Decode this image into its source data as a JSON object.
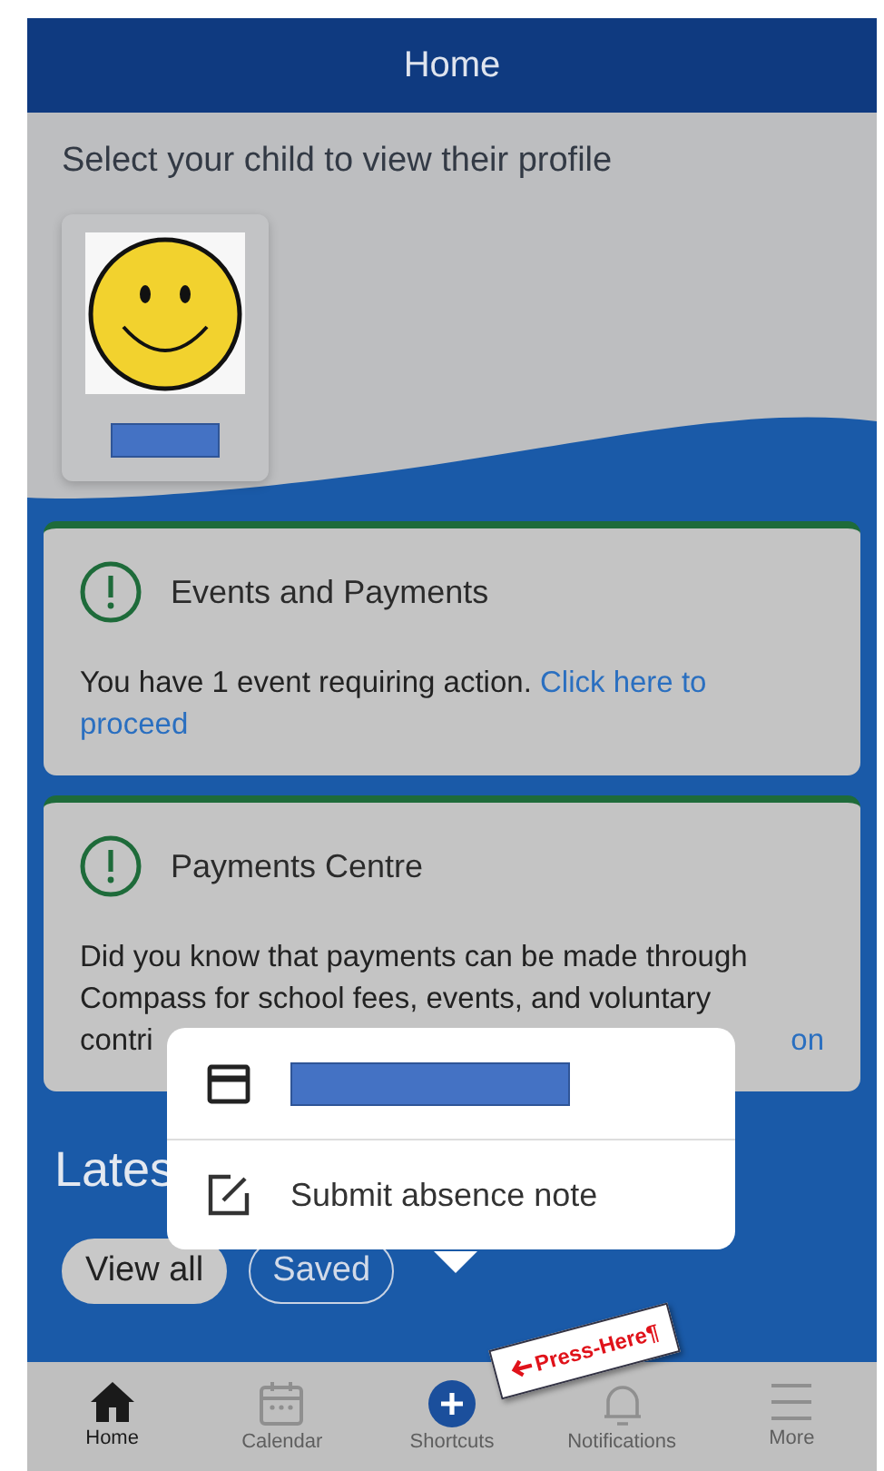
{
  "header": {
    "title": "Home"
  },
  "children_section": {
    "prompt": "Select your child to view their profile",
    "children": [
      {
        "name_redacted": true
      }
    ]
  },
  "cards": [
    {
      "title": "Events and Payments",
      "lines": [
        {
          "text": "You have 1 event requiring action. ",
          "link": "Click here to"
        },
        {
          "link": "proceed"
        }
      ]
    },
    {
      "title": "Payments Centre",
      "lines": [
        {
          "text": "Did you know that payments can be made through"
        },
        {
          "text": "Compass for school fees, events, and voluntary"
        },
        {
          "text": "contri",
          "link": "on"
        }
      ]
    }
  ],
  "latest": {
    "heading": "Lates",
    "filters": [
      {
        "label": "View all",
        "selected": true
      },
      {
        "label": "Saved",
        "selected": false
      }
    ]
  },
  "popup": {
    "items": [
      {
        "kind": "redacted"
      },
      {
        "kind": "action",
        "label": "Submit absence note"
      }
    ]
  },
  "annotation": {
    "label": "Press-Here¶"
  },
  "nav": [
    {
      "kind": "home",
      "label": "Home",
      "selected": true
    },
    {
      "kind": "calendar",
      "label": "Calendar",
      "selected": false
    },
    {
      "kind": "add",
      "label": "Shortcuts",
      "selected": false
    },
    {
      "kind": "bell",
      "label": "Notifications",
      "selected": false
    },
    {
      "kind": "menu",
      "label": "More",
      "selected": false
    }
  ]
}
